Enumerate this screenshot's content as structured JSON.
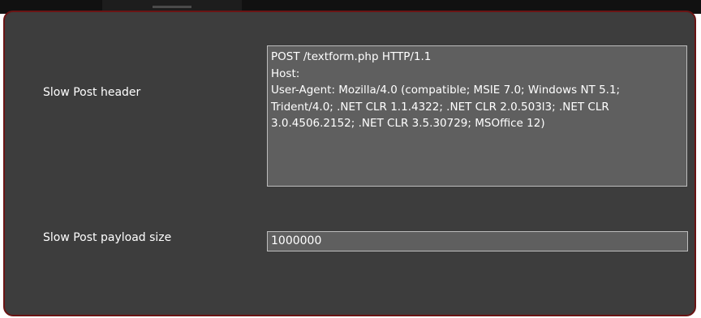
{
  "settings": {
    "slow_post_header": {
      "label": "Slow Post header",
      "value": "POST /textform.php HTTP/1.1\nHost:\nUser-Agent: Mozilla/4.0 (compatible; MSIE 7.0; Windows NT 5.1; Trident/4.0; .NET CLR 1.1.4322; .NET CLR 2.0.503l3; .NET CLR 3.0.4506.2152; .NET CLR 3.5.30729; MSOffice 12)"
    },
    "slow_post_payload_size": {
      "label": "Slow Post payload size",
      "value": "1000000"
    }
  },
  "colors": {
    "panel_bg": "#3d3d3d",
    "panel_border": "#6a1414",
    "field_bg": "#5f5f5f",
    "field_border": "#bdbdbd",
    "text": "#ffffff"
  }
}
